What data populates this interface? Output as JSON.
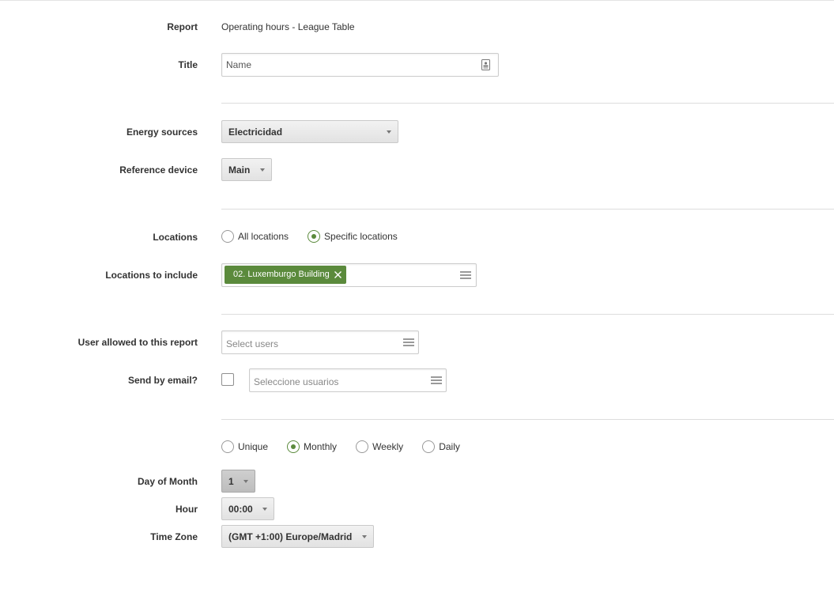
{
  "form": {
    "report": {
      "label": "Report",
      "value": "Operating hours - League Table"
    },
    "title": {
      "label": "Title",
      "value": "Name",
      "icon": "contact-card-icon"
    },
    "energy_sources": {
      "label": "Energy sources",
      "selected": "Electricidad"
    },
    "reference_device": {
      "label": "Reference device",
      "selected": "Main"
    },
    "locations": {
      "label": "Locations",
      "options": [
        {
          "label": "All locations",
          "checked": false
        },
        {
          "label": "Specific locations",
          "checked": true
        }
      ]
    },
    "locations_to_include": {
      "label": "Locations to include",
      "tags": [
        {
          "label": "02. Luxemburgo Building"
        }
      ]
    },
    "users_allowed": {
      "label": "User allowed to this report",
      "placeholder": "Select users"
    },
    "send_by_email": {
      "label": "Send by email?",
      "checked": false,
      "placeholder": "Seleccione usuarios"
    },
    "frequency": {
      "options": [
        {
          "label": "Unique",
          "checked": false
        },
        {
          "label": "Monthly",
          "checked": true
        },
        {
          "label": "Weekly",
          "checked": false
        },
        {
          "label": "Daily",
          "checked": false
        }
      ]
    },
    "day_of_month": {
      "label": "Day of Month",
      "selected": "1"
    },
    "hour": {
      "label": "Hour",
      "selected": "00:00"
    },
    "time_zone": {
      "label": "Time Zone",
      "selected": "(GMT +1:00) Europe/Madrid"
    }
  },
  "colors": {
    "accent": "#5b8a3c",
    "divider": "#dddddd",
    "select_bg": "#e6e6e6"
  }
}
